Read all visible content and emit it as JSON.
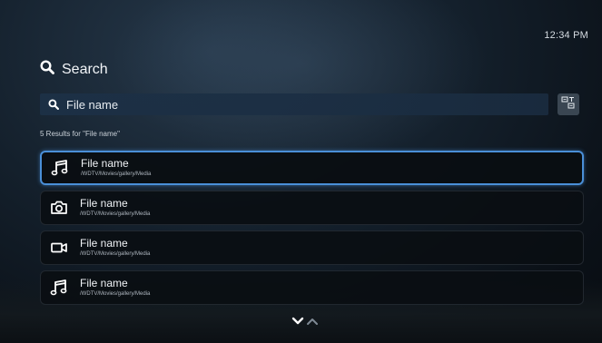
{
  "status": {
    "time": "12:34 PM"
  },
  "header": {
    "title": "Search",
    "icon": "search-icon"
  },
  "search": {
    "value": "File name",
    "icon": "search-icon",
    "keyboard_button_icon": "keyboard-toggle-icon"
  },
  "results": {
    "count_label": "5 Results for \"File name\"",
    "items": [
      {
        "name": "File name",
        "path": "/WDTV/Movies/gallery/Media",
        "icon": "music-note-icon",
        "selected": true
      },
      {
        "name": "File name",
        "path": "/WDTV/Movies/gallery/Media",
        "icon": "camera-icon",
        "selected": false
      },
      {
        "name": "File name",
        "path": "/WDTV/Movies/gallery/Media",
        "icon": "video-camera-icon",
        "selected": false
      },
      {
        "name": "File name",
        "path": "/WDTV/Movies/gallery/Media",
        "icon": "music-note-icon",
        "selected": false
      }
    ]
  },
  "scroll": {
    "down_icon": "chevron-down-icon",
    "up_icon": "chevron-up-icon"
  },
  "colors": {
    "accent": "#4a8fd8",
    "search_bar": "#1c3046"
  }
}
